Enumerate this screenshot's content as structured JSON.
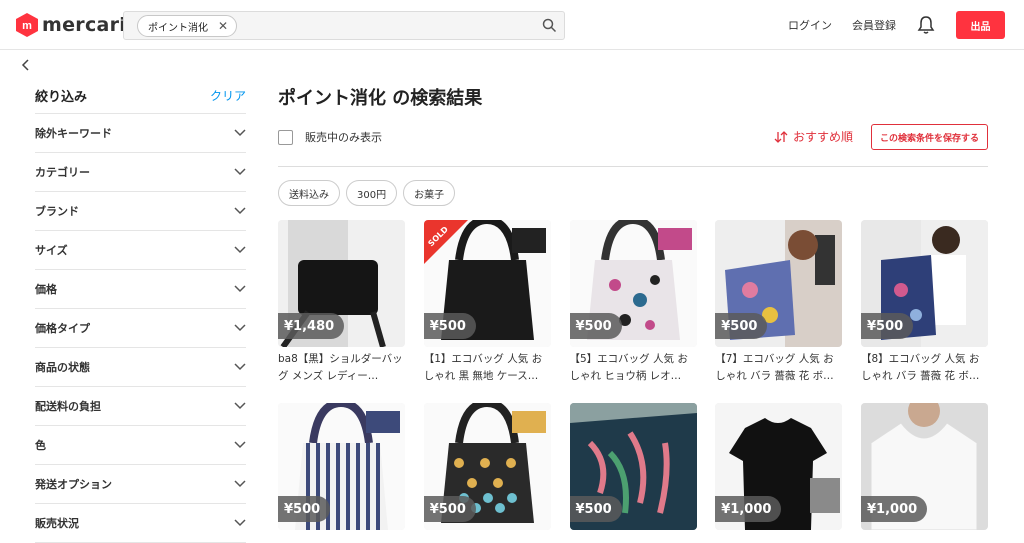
{
  "header": {
    "logo_text": "mercari",
    "search_chip": "ポイント消化",
    "login": "ログイン",
    "register": "会員登録",
    "sell": "出品"
  },
  "sidebar": {
    "title": "絞り込み",
    "clear": "クリア",
    "items": [
      "除外キーワード",
      "カテゴリー",
      "ブランド",
      "サイズ",
      "価格",
      "価格タイプ",
      "商品の状態",
      "配送料の負担",
      "色",
      "発送オプション",
      "販売状況"
    ]
  },
  "main": {
    "title": "ポイント消化 の検索結果",
    "on_sale_label": "販売中のみ表示",
    "sort_label": "おすすめ順",
    "save_label": "この検索条件を保存する",
    "tags": [
      "送料込み",
      "300円",
      "お菓子"
    ]
  },
  "products": [
    {
      "price": "¥1,480",
      "title": "ba8【黒】ショルダーバッグ メンズ レディー…",
      "sold": false,
      "image": "black-shoulder-bag"
    },
    {
      "price": "¥500",
      "title": "【1】エコバッグ 人気 おしゃれ 黒 無地 ケース…",
      "sold": true,
      "sold_label": "SOLD",
      "image": "black-eco-bag"
    },
    {
      "price": "¥500",
      "title": "【5】エコバッグ 人気 おしゃれ ヒョウ柄 レオ…",
      "sold": false,
      "image": "leopard-eco-bag"
    },
    {
      "price": "¥500",
      "title": "【7】エコバッグ 人気 おしゃれ バラ 薔薇 花 ボ…",
      "sold": false,
      "image": "rose-eco-bag-model"
    },
    {
      "price": "¥500",
      "title": "【8】エコバッグ 人気 おしゃれ バラ 薔薇 花 ボ…",
      "sold": false,
      "image": "floral-eco-bag-model"
    },
    {
      "price": "¥500",
      "title": "",
      "sold": false,
      "image": "striped-eco-bag"
    },
    {
      "price": "¥500",
      "title": "",
      "sold": false,
      "image": "hexagon-eco-bag"
    },
    {
      "price": "¥500",
      "title": "",
      "sold": false,
      "image": "leaf-eco-bag"
    },
    {
      "price": "¥1,000",
      "title": "",
      "sold": false,
      "image": "black-tshirt"
    },
    {
      "price": "¥1,000",
      "title": "",
      "sold": false,
      "image": "white-tshirt"
    }
  ],
  "colors": {
    "accent": "#ff333f",
    "link": "#0095ee"
  }
}
